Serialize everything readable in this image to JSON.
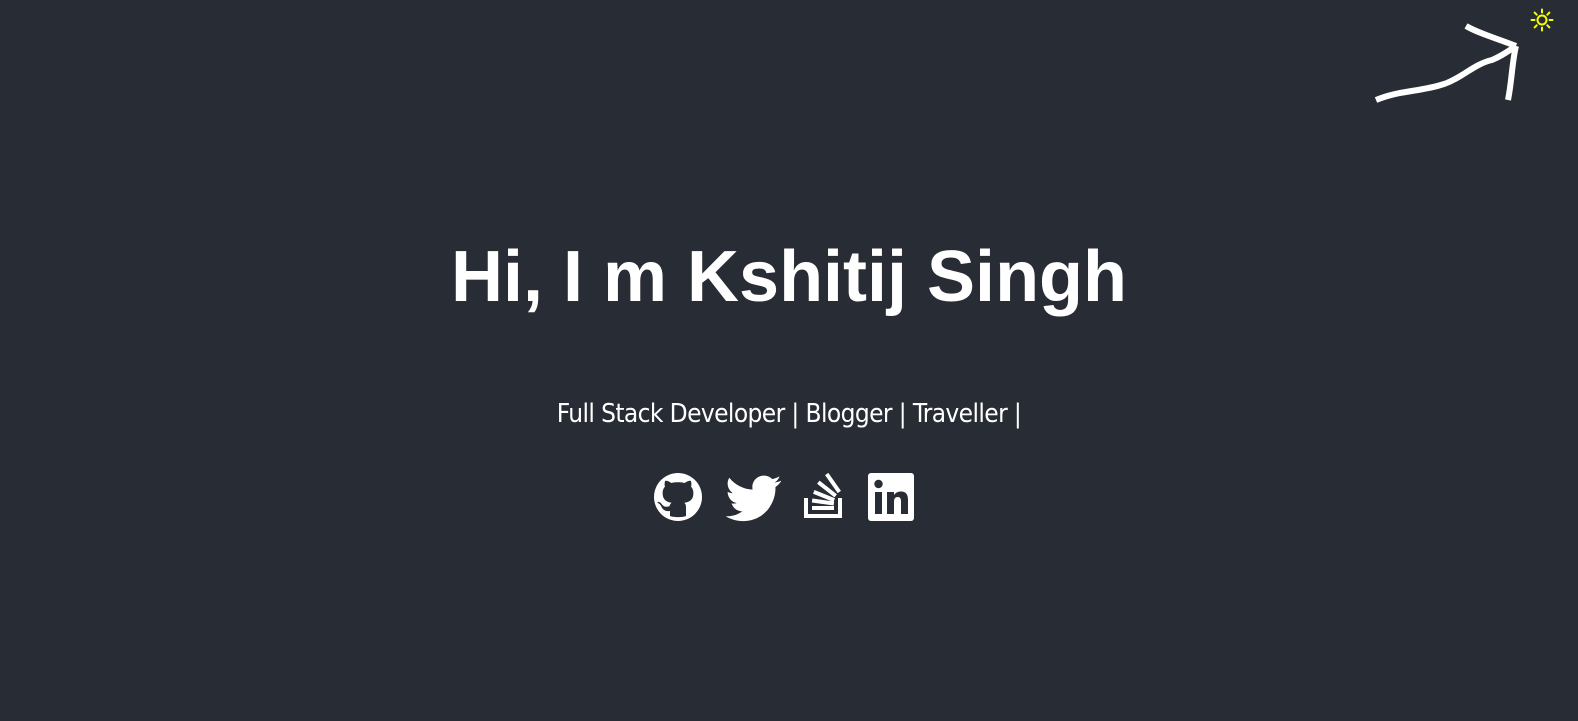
{
  "theme_toggle": {
    "icon": "sun-icon",
    "color": "#f6ff00"
  },
  "hint": {
    "icon": "arrow-pointer",
    "color": "#ffffff"
  },
  "hero": {
    "title": "Hi, I m Kshitij Singh",
    "subtitle": "Full Stack Developer | Blogger | Traveller |"
  },
  "social_links": [
    {
      "name": "GitHub",
      "icon": "github-icon"
    },
    {
      "name": "Twitter",
      "icon": "twitter-icon"
    },
    {
      "name": "Stack Overflow",
      "icon": "stackoverflow-icon"
    },
    {
      "name": "LinkedIn",
      "icon": "linkedin-icon"
    }
  ],
  "colors": {
    "background": "#282c34",
    "text": "#ffffff",
    "accent": "#f6ff00"
  }
}
